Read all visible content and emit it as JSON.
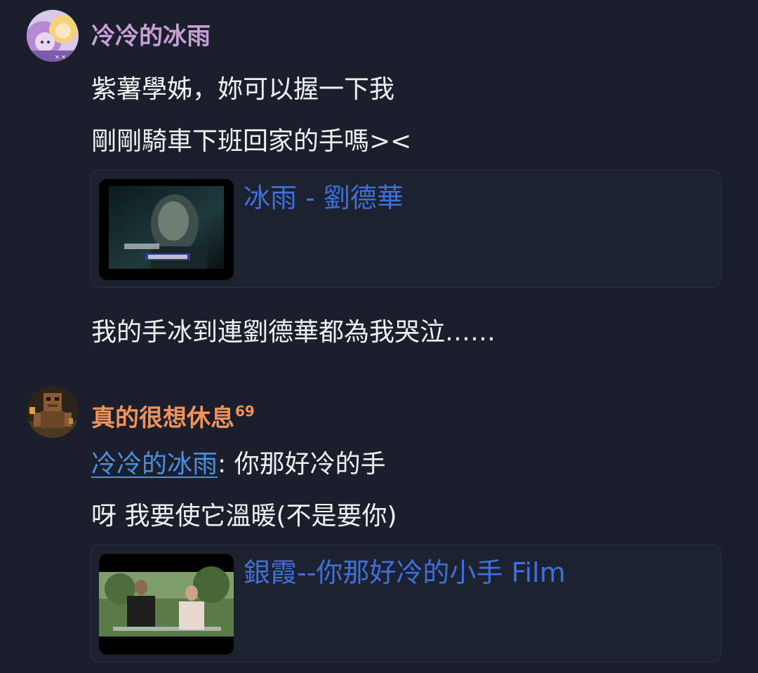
{
  "messages": [
    {
      "author": {
        "name": "冷冷的冰雨",
        "color": "#c89fd6"
      },
      "lines": [
        "紫薯學姊，妳可以握一下我",
        "剛剛騎車下班回家的手嗎><"
      ],
      "embed": {
        "title": "冰雨 - 劉德華",
        "link_color": "#3f6fd8"
      },
      "after_embed": "我的手冰到連劉德華都為我哭泣……"
    },
    {
      "author": {
        "name": "真的很想休息",
        "superscript": "69",
        "color": "#f0935a"
      },
      "mention": "冷冷的冰雨",
      "mention_rest": ": 你那好冷的手",
      "lines": [
        "呀 我要使它溫暖(不是要你)"
      ],
      "embed": {
        "title": "銀霞--你那好冷的小手 Film",
        "link_color": "#3f6fd8"
      }
    }
  ],
  "colors": {
    "background": "#1b1f2b",
    "text": "#f0f1f3",
    "mention": "#4a90e2",
    "embed_border": "#2b3142"
  }
}
